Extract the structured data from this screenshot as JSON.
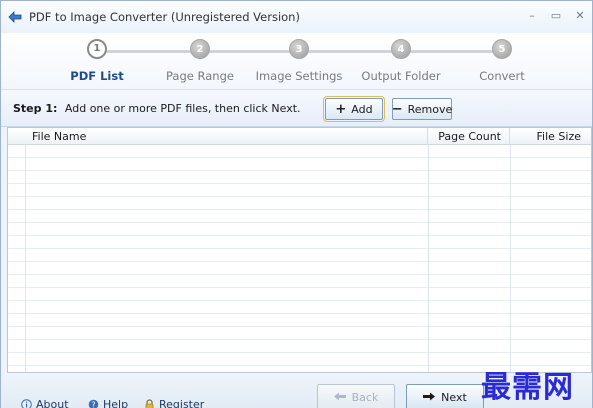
{
  "window": {
    "title": "PDF to Image Converter (Unregistered Version)",
    "controls": {
      "minimize": "–",
      "maximize": "▭",
      "close": "✕"
    }
  },
  "steps": [
    {
      "number": "1",
      "label": "PDF List",
      "active": true
    },
    {
      "number": "2",
      "label": "Page Range",
      "active": false
    },
    {
      "number": "3",
      "label": "Image Settings",
      "active": false
    },
    {
      "number": "4",
      "label": "Output Folder",
      "active": false
    },
    {
      "number": "5",
      "label": "Convert",
      "active": false
    }
  ],
  "instruction": {
    "step_label": "Step 1:",
    "text": "Add one or more PDF files, then click Next."
  },
  "toolbar": {
    "add_label": "Add",
    "add_icon": "plus-icon",
    "remove_label": "Remove",
    "remove_icon": "minus-icon"
  },
  "file_list": {
    "columns": [
      "File Name",
      "Page Count",
      "File Size"
    ],
    "rows": []
  },
  "footer": {
    "about_label": "About",
    "help_label": "Help",
    "register_label": "Register",
    "back_label": "Back",
    "next_label": "Next",
    "back_enabled": false,
    "next_enabled": true
  },
  "watermark": "最需网",
  "colors": {
    "accent": "#1f4c85",
    "watermark": "#2b2bd6"
  }
}
